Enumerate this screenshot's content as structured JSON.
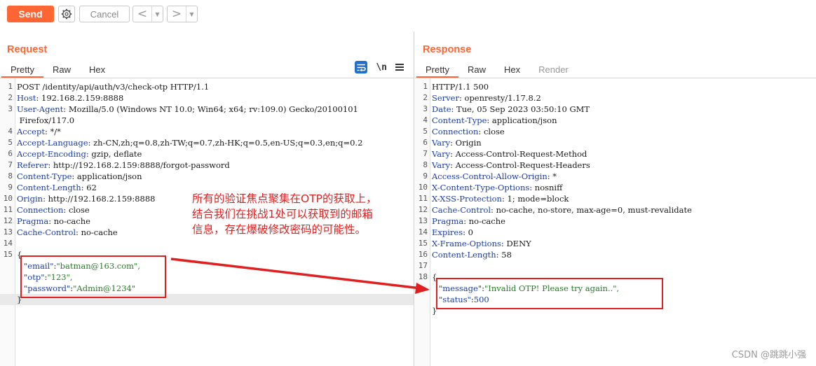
{
  "toolbar": {
    "send_label": "Send",
    "cancel_label": "Cancel",
    "back_arrow": "<",
    "forward_arrow": ">",
    "dropdown_glyph": "▼"
  },
  "request": {
    "title": "Request",
    "tabs": [
      "Pretty",
      "Raw",
      "Hex"
    ],
    "active_tab": "Pretty",
    "newline_toggle": "\\n",
    "lines": [
      {
        "n": "1",
        "k": "",
        "v": "POST /identity/api/auth/v3/check-otp HTTP/1.1"
      },
      {
        "n": "2",
        "k": "Host",
        "v": " 192.168.2.159:8888"
      },
      {
        "n": "3",
        "k": "User-Agent",
        "v": " Mozilla/5.0 (Windows NT 10.0; Win64; x64; rv:109.0) Gecko/20100101"
      },
      {
        "n": "",
        "k": "",
        "v": " Firefox/117.0"
      },
      {
        "n": "4",
        "k": "Accept",
        "v": " */*"
      },
      {
        "n": "5",
        "k": "Accept-Language",
        "v": " zh-CN,zh;q=0.8,zh-TW;q=0.7,zh-HK;q=0.5,en-US;q=0.3,en;q=0.2"
      },
      {
        "n": "6",
        "k": "Accept-Encoding",
        "v": " gzip, deflate"
      },
      {
        "n": "7",
        "k": "Referer",
        "v": " http://192.168.2.159:8888/forgot-password"
      },
      {
        "n": "8",
        "k": "Content-Type",
        "v": " application/json"
      },
      {
        "n": "9",
        "k": "Content-Length",
        "v": " 62"
      },
      {
        "n": "10",
        "k": "Origin",
        "v": " http://192.168.2.159:8888"
      },
      {
        "n": "11",
        "k": "Connection",
        "v": " close"
      },
      {
        "n": "12",
        "k": "Pragma",
        "v": " no-cache"
      },
      {
        "n": "13",
        "k": "Cache-Control",
        "v": " no-cache"
      },
      {
        "n": "14",
        "k": "",
        "v": ""
      },
      {
        "n": "15",
        "k": "",
        "v": "{"
      },
      {
        "n": "",
        "k": "\"email\"",
        "v": "\"batman@163.com\","
      },
      {
        "n": "",
        "k": "\"otp\"",
        "v": "\"123\","
      },
      {
        "n": "",
        "k": "\"password\"",
        "v": "\"Admin@1234\""
      },
      {
        "n": "",
        "k": "",
        "v": "}"
      }
    ]
  },
  "response": {
    "title": "Response",
    "tabs": [
      "Pretty",
      "Raw",
      "Hex",
      "Render"
    ],
    "active_tab": "Pretty",
    "lines": [
      {
        "n": "1",
        "k": "",
        "v": "HTTP/1.1 500"
      },
      {
        "n": "2",
        "k": "Server",
        "v": " openresty/1.17.8.2"
      },
      {
        "n": "3",
        "k": "Date",
        "v": " Tue, 05 Sep 2023 03:50:10 GMT"
      },
      {
        "n": "4",
        "k": "Content-Type",
        "v": " application/json"
      },
      {
        "n": "5",
        "k": "Connection",
        "v": " close"
      },
      {
        "n": "6",
        "k": "Vary",
        "v": " Origin"
      },
      {
        "n": "7",
        "k": "Vary",
        "v": " Access-Control-Request-Method"
      },
      {
        "n": "8",
        "k": "Vary",
        "v": " Access-Control-Request-Headers"
      },
      {
        "n": "9",
        "k": "Access-Control-Allow-Origin",
        "v": " *"
      },
      {
        "n": "10",
        "k": "X-Content-Type-Options",
        "v": " nosniff"
      },
      {
        "n": "11",
        "k": "X-XSS-Protection",
        "v": " 1; mode=block"
      },
      {
        "n": "12",
        "k": "Cache-Control",
        "v": " no-cache, no-store, max-age=0, must-revalidate"
      },
      {
        "n": "13",
        "k": "Pragma",
        "v": " no-cache"
      },
      {
        "n": "14",
        "k": "Expires",
        "v": " 0"
      },
      {
        "n": "15",
        "k": "X-Frame-Options",
        "v": " DENY"
      },
      {
        "n": "16",
        "k": "Content-Length",
        "v": " 58"
      },
      {
        "n": "17",
        "k": "",
        "v": ""
      },
      {
        "n": "18",
        "k": "",
        "v": "{"
      },
      {
        "n": "",
        "k": "\"message\"",
        "v": "\"Invalid OTP! Please try again..\","
      },
      {
        "n": "",
        "k": "\"status\"",
        "v": "500"
      },
      {
        "n": "",
        "k": "",
        "v": "}"
      }
    ]
  },
  "annotation": {
    "text_lines": [
      "所有的验证焦点聚集在OTP的获取上，",
      "结合我们在挑战1处可以获取到的邮箱",
      "信息，存在爆破修改密码的可能性。"
    ],
    "color": "#e02020"
  },
  "watermark": "CSDN @跳跳小强",
  "colors": {
    "accent": "#ff6633",
    "header_name": "#1c3ea8",
    "string_value": "#2c7a2c",
    "annotation_red": "#e02020",
    "wrap_icon": "#1f6fd1"
  }
}
